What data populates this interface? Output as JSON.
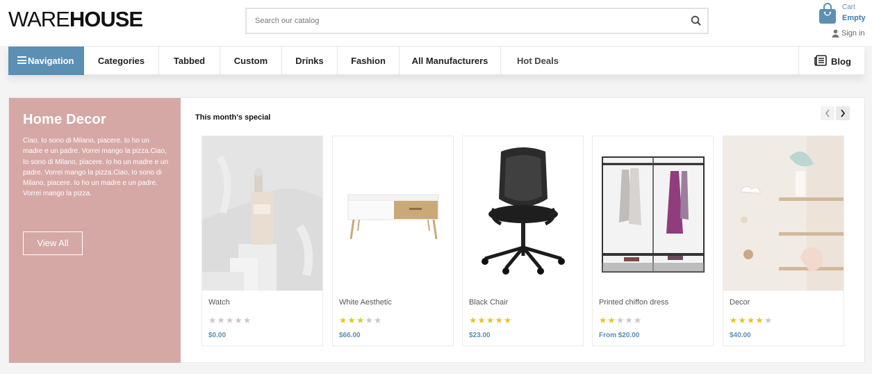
{
  "brand": {
    "logo_thin": "WARE",
    "logo_bold": "HOUSE"
  },
  "search": {
    "placeholder": "Search our catalog",
    "icon": "search-icon"
  },
  "cart": {
    "label": "Cart",
    "status": "Empty",
    "icon": "shopping-bag-icon"
  },
  "account": {
    "signin_label": "Sign in",
    "icon": "user-icon"
  },
  "nav": {
    "main_label": "Navigation",
    "items": [
      "Categories",
      "Tabbed",
      "Custom",
      "Drinks",
      "Fashion",
      "All Manufacturers",
      "Hot Deals"
    ],
    "blog_label": "Blog"
  },
  "promo": {
    "title": "Home Decor",
    "text": "Ciao, Io sono di Milano, piacere. Io ho un madre e un padre. Vorrei mango la pizza.Ciao, Io sono di Milano, piacere. Io ho un madre e un padre. Vorrei mango la pizza.Ciao, Io sono di Milano, piacere. Io ho un madre e un padre. Vorrei mango la pizza.",
    "button_label": "View All"
  },
  "special": {
    "title": "This month's special"
  },
  "products": [
    {
      "name": "Watch",
      "rating": 0,
      "price": "$0.00"
    },
    {
      "name": "White Aesthetic",
      "rating": 3,
      "price": "$66.00"
    },
    {
      "name": "Black Chair",
      "rating": 5,
      "price": "$23.00"
    },
    {
      "name": "Printed chiffon dress",
      "rating": 2,
      "price": "From $20.00"
    },
    {
      "name": "Decor",
      "rating": 4,
      "price": "$40.00"
    }
  ],
  "colors": {
    "accent": "#5b8fb4",
    "promo_bg": "#d5a8a6",
    "star": "#e3c32a"
  }
}
